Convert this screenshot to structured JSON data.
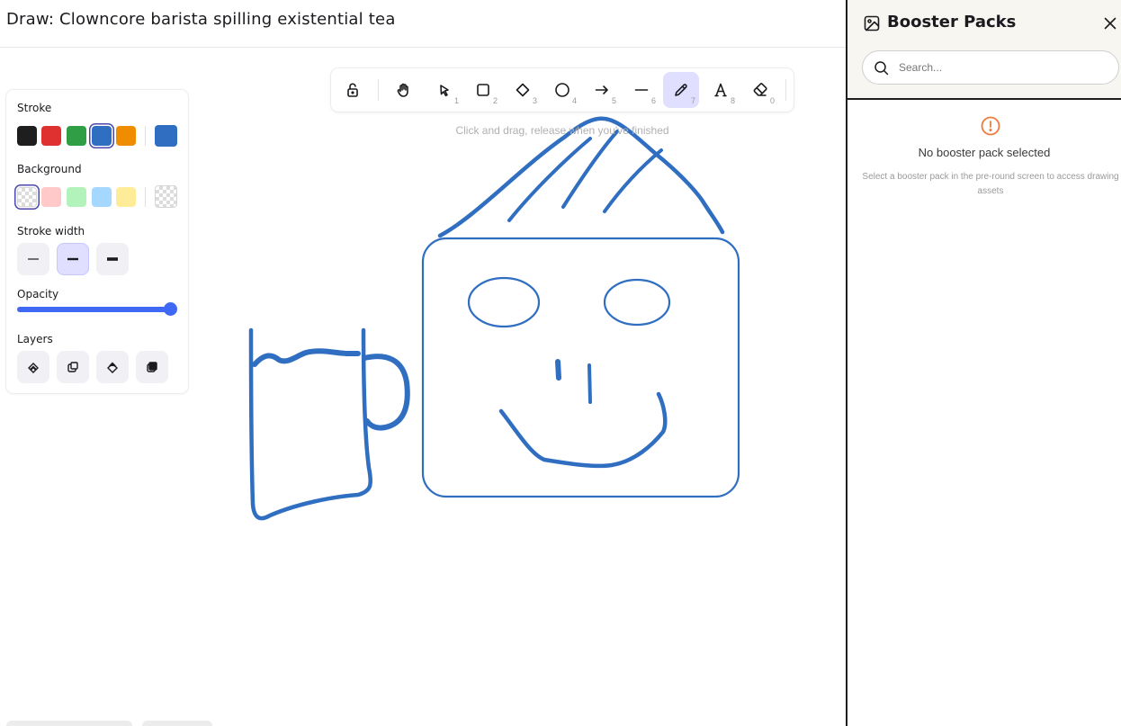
{
  "header": {
    "title": "Draw: Clowncore barista spilling existential tea"
  },
  "canvas": {
    "hint": "Click and drag, release when you've finished",
    "stroke_color": "#2f6ec0"
  },
  "toolbar": {
    "tools": [
      {
        "name": "lock-icon",
        "key": ""
      },
      {
        "name": "hand-icon",
        "key": ""
      },
      {
        "name": "selection-icon",
        "key": "1"
      },
      {
        "name": "rectangle-icon",
        "key": "2"
      },
      {
        "name": "diamond-icon",
        "key": "3"
      },
      {
        "name": "ellipse-icon",
        "key": "4"
      },
      {
        "name": "arrow-icon",
        "key": "5"
      },
      {
        "name": "line-icon",
        "key": "6"
      },
      {
        "name": "pencil-icon",
        "key": "7",
        "active": true
      },
      {
        "name": "text-icon",
        "key": "8"
      },
      {
        "name": "eraser-icon",
        "key": "0"
      }
    ]
  },
  "properties": {
    "stroke_label": "Stroke",
    "stroke_colors": [
      "#1e1e1e",
      "#e03131",
      "#2f9e44",
      "#2f6ec0",
      "#f08c00"
    ],
    "stroke_current": "#2f6ec0",
    "background_label": "Background",
    "background_colors": [
      "transparent",
      "#ffc9c9",
      "#b2f2bb",
      "#a5d8ff",
      "#ffec99"
    ],
    "stroke_width_label": "Stroke width",
    "opacity_label": "Opacity",
    "opacity_value": 1.0,
    "layers_label": "Layers"
  },
  "sidebar": {
    "title": "Booster Packs",
    "search_placeholder": "Search...",
    "empty_title": "No booster pack selected",
    "empty_desc": "Select a booster pack in the pre-round screen to access drawing assets",
    "accent_color": "#f07a3c"
  }
}
